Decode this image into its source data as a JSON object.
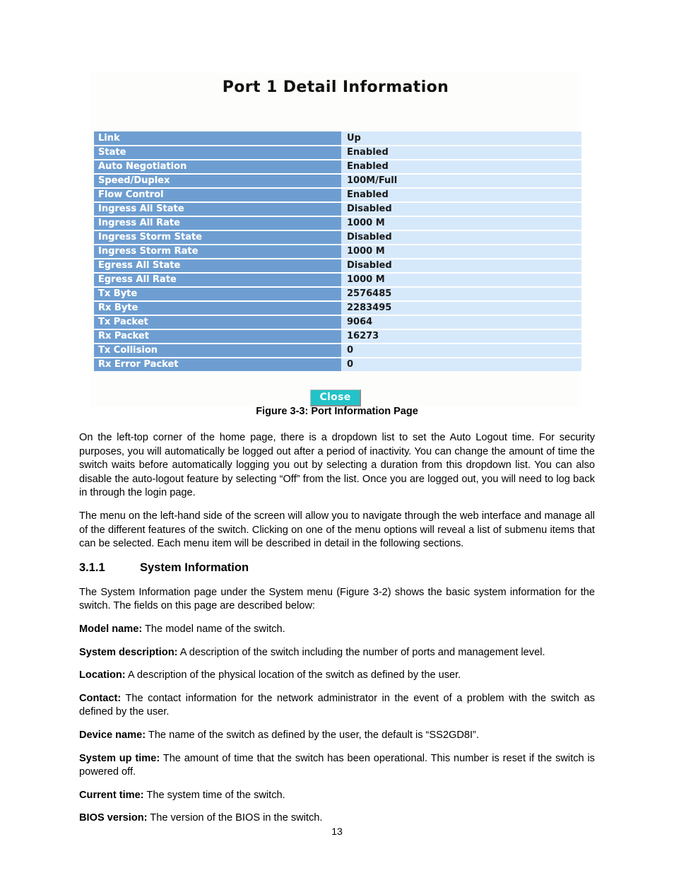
{
  "figure": {
    "ui_title": "Port 1 Detail Information",
    "close_label": "Close",
    "caption": "Figure 3-3: Port Information Page",
    "colors": {
      "label_cell": "#6e9ed1",
      "value_cell": "#d6e9fb",
      "close_button": "#22c3c8",
      "panel_background": "#fdfdfb"
    },
    "rows": [
      {
        "label": "Link",
        "value": "Up"
      },
      {
        "label": "State",
        "value": "Enabled"
      },
      {
        "label": "Auto Negotiation",
        "value": "Enabled"
      },
      {
        "label": "Speed/Duplex",
        "value": "100M/Full"
      },
      {
        "label": "Flow Control",
        "value": "Enabled"
      },
      {
        "label": "Ingress All State",
        "value": "Disabled"
      },
      {
        "label": "Ingress All Rate",
        "value": "1000 M"
      },
      {
        "label": "Ingress Storm State",
        "value": "Disabled"
      },
      {
        "label": "Ingress Storm Rate",
        "value": "1000 M"
      },
      {
        "label": "Egress All State",
        "value": "Disabled"
      },
      {
        "label": "Egress All Rate",
        "value": "1000 M"
      },
      {
        "label": "Tx Byte",
        "value": "2576485"
      },
      {
        "label": "Rx Byte",
        "value": "2283495"
      },
      {
        "label": "Tx Packet",
        "value": "9064"
      },
      {
        "label": "Rx Packet",
        "value": "16273"
      },
      {
        "label": "Tx Collision",
        "value": "0"
      },
      {
        "label": "Rx Error Packet",
        "value": "0"
      }
    ]
  },
  "body": {
    "para_1": "On the left-top corner of the home page, there is a dropdown list to set the Auto Logout time. For security purposes, you will automatically be logged out after a period of inactivity. You can change the amount of time the switch waits before automatically logging you out by selecting a duration from this dropdown list. You can also disable the auto-logout feature by selecting “Off” from the list. Once you are logged out, you will need to log back in through the login page.",
    "para_2": "The menu on the left-hand side of the screen will allow you to navigate through the web interface and manage all of the different features of the switch. Clicking on one of the menu options will reveal a list of submenu items that can be selected. Each menu item will be described in detail in the following sections.",
    "section": {
      "number": "3.1.1",
      "title": "System Information"
    },
    "para_3": "The System Information page under the System menu (Figure 3-2) shows the basic system information for the switch. The fields on this page are described below:",
    "fields": [
      {
        "term": "Model name:",
        "desc": " The model name of the switch."
      },
      {
        "term": "System description:",
        "desc": " A description of the switch including the number of ports and management level."
      },
      {
        "term": "Location:",
        "desc": " A description of the physical location of the switch as defined by the user."
      },
      {
        "term": "Contact:",
        "desc": " The contact information for the network administrator in the event of a problem with the switch as defined by the user."
      },
      {
        "term": "Device name:",
        "desc": " The name of the switch as defined by the user, the default is “SS2GD8I”."
      },
      {
        "term": "System up time:",
        "desc": " The amount of time that the switch has been operational. This number is reset if the switch is powered off."
      },
      {
        "term": "Current time:",
        "desc": " The system time of the switch."
      },
      {
        "term": "BIOS version:",
        "desc": " The version of the BIOS in the switch."
      }
    ]
  },
  "footer": {
    "page_number": "13"
  }
}
